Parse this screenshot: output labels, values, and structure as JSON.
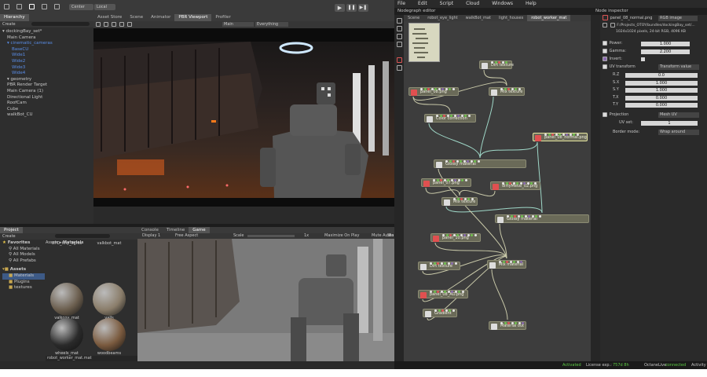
{
  "toolbar": {
    "center_label": "Center",
    "local_label": "Local",
    "tabs": [
      "Asset Store",
      "Scene",
      "Animator",
      "PBR Viewport",
      "Profiler"
    ],
    "scene_dropdown": "Main",
    "layers_dropdown": "Everything"
  },
  "hierarchy": {
    "title": "Hierarchy",
    "create_label": "Create",
    "items": [
      {
        "label": "dockingBay_set*",
        "sel": false,
        "depth": 0
      },
      {
        "label": "Main Camera",
        "sel": false,
        "depth": 1
      },
      {
        "label": "cinematic_cameras",
        "sel": true,
        "depth": 1
      },
      {
        "label": "BaseCU",
        "sel": true,
        "depth": 2
      },
      {
        "label": "Wide1",
        "sel": true,
        "depth": 2
      },
      {
        "label": "Wide2",
        "sel": true,
        "depth": 2
      },
      {
        "label": "Wide3",
        "sel": true,
        "depth": 2
      },
      {
        "label": "Wide4",
        "sel": true,
        "depth": 2
      },
      {
        "label": "geometry",
        "sel": false,
        "depth": 1
      },
      {
        "label": "PBR Render Target",
        "sel": false,
        "depth": 1
      },
      {
        "label": "Main Camera (1)",
        "sel": false,
        "depth": 1
      },
      {
        "label": "Directional Light",
        "sel": false,
        "depth": 1
      },
      {
        "label": "RoofCam",
        "sel": false,
        "depth": 1
      },
      {
        "label": "Cube",
        "sel": false,
        "depth": 1
      },
      {
        "label": "walkBot_CU",
        "sel": false,
        "depth": 1
      }
    ]
  },
  "project": {
    "title": "Project",
    "create_label": "Create",
    "favorites_label": "Favorites",
    "favorites": [
      "All Materials",
      "All Models",
      "All Prefabs"
    ],
    "assets_label": "Assets",
    "folders": [
      "Materials",
      "Plugins",
      "textures"
    ],
    "breadcrumb_root": "Assets",
    "breadcrumb_leaf": "Materials",
    "materials": [
      {
        "name": "UFO_tiny_lights",
        "color": "#555"
      },
      {
        "name": "valkbot_mat",
        "color": "#666"
      },
      {
        "name": "valkcoy_mat",
        "color": "#6b5e4e"
      },
      {
        "name": "valls",
        "color": "#8a7d6a"
      },
      {
        "name": "wheels_mat",
        "color": "#2a2a2a"
      },
      {
        "name": "woodbeams",
        "color": "#7a5a3e"
      }
    ],
    "footer_file": "robot_worker_mat.mat"
  },
  "game": {
    "tabs": [
      "Console",
      "Timeline",
      "Game"
    ],
    "display": "Display 1",
    "aspect": "Free Aspect",
    "scale_label": "Scale",
    "scale_value": "1x",
    "maximize": "Maximize On Play",
    "mute": "Mute Audio",
    "stats": "Sta"
  },
  "menu": {
    "items": [
      "File",
      "Edit",
      "Script",
      "Cloud",
      "Windows",
      "Help"
    ]
  },
  "nodegraph": {
    "title": "Nodegraph editor",
    "tabs": [
      "Scene",
      "robot_eye_light",
      "walkBot_mat",
      "light_houses",
      "robot_worker_mat"
    ],
    "nodes": [
      {
        "id": "dirt1",
        "label": "Dirt texture"
      },
      {
        "id": "panel08",
        "label": "panel_08.png"
      },
      {
        "id": "mixtex1",
        "label": "Mix texture"
      },
      {
        "id": "colorcorr",
        "label": "Color correction"
      },
      {
        "id": "panel08n",
        "label": "panel_08_normal.png"
      },
      {
        "id": "glossy1",
        "label": "Glossy material"
      },
      {
        "id": "panel07",
        "label": "panel_07.png"
      },
      {
        "id": "dirtymetal",
        "label": "dirtyMetal_02.png"
      },
      {
        "id": "mixtex2",
        "label": "Mix texture"
      },
      {
        "id": "glossy2",
        "label": "Glossy material"
      },
      {
        "id": "panel10",
        "label": "panel_10.png"
      },
      {
        "id": "dirt2",
        "label": "Dirt texture"
      },
      {
        "id": "mixmat",
        "label": "Mix material"
      },
      {
        "id": "panel08ao",
        "label": "panel_08_AO.png"
      },
      {
        "id": "gradient",
        "label": "Gradient"
      },
      {
        "id": "matout",
        "label": "Material out"
      }
    ]
  },
  "inspector": {
    "title": "Node inspector",
    "node_name": "panel_08_normal.png",
    "node_type": "RGB image",
    "file_path": "F:/Projects_OTOY/bundles/dockingBay_set/...",
    "file_info": "1024x1024 pixels, 24-bit RGB, 4096 KB",
    "power_label": "Power:",
    "power_value": "1.000",
    "gamma_label": "Gamma:",
    "gamma_value": "2.200",
    "invert_label": "Invert:",
    "uv_label": "UV transform",
    "uv_value": "Transform value",
    "rz_label": "R.Z",
    "rz_value": "0.0",
    "sx_label": "S.X",
    "sx_value": "1.000",
    "sy_label": "S.Y",
    "sy_value": "1.000",
    "tx_label": "T.X",
    "tx_value": "0.000",
    "ty_label": "T.Y",
    "ty_value": "0.000",
    "proj_label": "Projection",
    "proj_value": "Mesh UV",
    "uvset_label": "UV set:",
    "uvset_value": "1",
    "border_label": "Border mode:",
    "border_value": "Wrap around"
  },
  "status": {
    "activated": "Activated",
    "license": "License exp.:",
    "license_days": "757d 8h",
    "octanelive": "OctaneLive:",
    "connected": "connected",
    "activity": "Activity"
  }
}
